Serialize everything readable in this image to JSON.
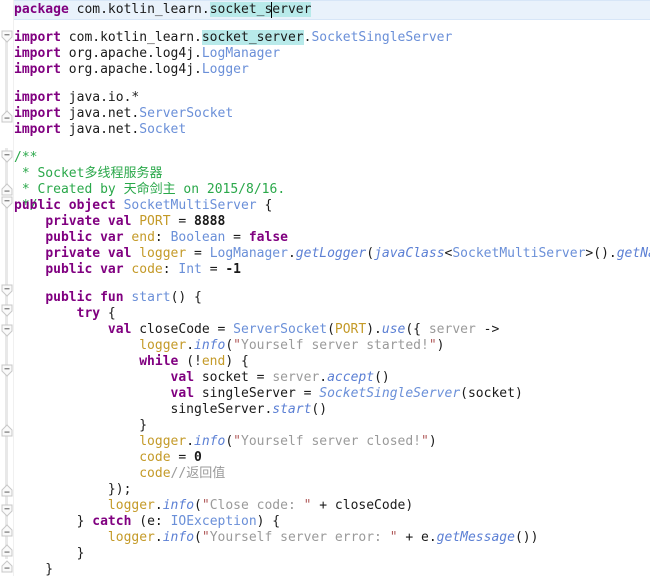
{
  "editor": {
    "language": "Kotlin",
    "file_package": "com.kotlin_learn.socket_server",
    "caret_line_index": 0,
    "highlight_token": "socket_server",
    "colors": {
      "background": "#ffffff",
      "caret_line": "#e9f2fb",
      "occurrence_highlight": "#b8eaea",
      "keyword": "#800080",
      "type": "#6a8fd8",
      "function": "#5b7fd4",
      "property": "#c49a28",
      "string": "#9a9a9a",
      "string_quote": "#b05a5a",
      "comment_block": "#2aa84a",
      "comment_line": "#9a9a9a",
      "number": "#1a1a1a",
      "gutter_rail": "#e8e8e8",
      "matched_brace": "#c87c20"
    }
  },
  "code": {
    "lines": [
      {
        "n": 1,
        "indent": 0,
        "text": "package com.kotlin_learn.socket_server"
      },
      {
        "n": 2,
        "indent": 0,
        "text": ""
      },
      {
        "n": 3,
        "indent": 0,
        "text": "import com.kotlin_learn.socket_server.SocketSingleServer"
      },
      {
        "n": 4,
        "indent": 0,
        "text": "import org.apache.log4j.LogManager"
      },
      {
        "n": 5,
        "indent": 0,
        "text": "import org.apache.log4j.Logger"
      },
      {
        "n": 6,
        "indent": 0,
        "text": ""
      },
      {
        "n": 7,
        "indent": 0,
        "text": "import java.io.*"
      },
      {
        "n": 8,
        "indent": 0,
        "text": "import java.net.ServerSocket"
      },
      {
        "n": 9,
        "indent": 0,
        "text": "import java.net.Socket"
      },
      {
        "n": 10,
        "indent": 0,
        "text": ""
      },
      {
        "n": 11,
        "indent": 0,
        "text": "/**"
      },
      {
        "n": 12,
        "indent": 0,
        "text": " * Socket多线程服务器"
      },
      {
        "n": 13,
        "indent": 0,
        "text": " * Created by 天命剑主 on 2015/8/16."
      },
      {
        "n": 14,
        "indent": 0,
        "text": " */"
      },
      {
        "n": 15,
        "indent": 0,
        "text": "public object SocketMultiServer {"
      },
      {
        "n": 16,
        "indent": 1,
        "text": "private val PORT = 8888"
      },
      {
        "n": 17,
        "indent": 1,
        "text": "public var end: Boolean = false"
      },
      {
        "n": 18,
        "indent": 1,
        "text": "private val logger = LogManager.getLogger(javaClass<SocketMultiServer>().getName())"
      },
      {
        "n": 19,
        "indent": 1,
        "text": "public var code: Int = -1"
      },
      {
        "n": 20,
        "indent": 0,
        "text": ""
      },
      {
        "n": 21,
        "indent": 1,
        "text": "public fun start() {"
      },
      {
        "n": 22,
        "indent": 2,
        "text": "try {"
      },
      {
        "n": 23,
        "indent": 3,
        "text": "val closeCode = ServerSocket(PORT).use({ server ->"
      },
      {
        "n": 24,
        "indent": 4,
        "text": "logger.info(\"Yourself server started!\")"
      },
      {
        "n": 25,
        "indent": 4,
        "text": "while (!end) {"
      },
      {
        "n": 26,
        "indent": 5,
        "text": "val socket = server.accept()"
      },
      {
        "n": 27,
        "indent": 5,
        "text": "val singleServer = SocketSingleServer(socket)"
      },
      {
        "n": 28,
        "indent": 5,
        "text": "singleServer.start()"
      },
      {
        "n": 29,
        "indent": 4,
        "text": "}"
      },
      {
        "n": 30,
        "indent": 4,
        "text": "logger.info(\"Yourself server closed!\")"
      },
      {
        "n": 31,
        "indent": 4,
        "text": "code = 0"
      },
      {
        "n": 32,
        "indent": 4,
        "text": "code//返回值"
      },
      {
        "n": 33,
        "indent": 3,
        "text": "});"
      },
      {
        "n": 34,
        "indent": 3,
        "text": "logger.info(\"Close code: \" + closeCode)"
      },
      {
        "n": 35,
        "indent": 2,
        "text": "} catch (e: IOException) {"
      },
      {
        "n": 36,
        "indent": 3,
        "text": "logger.info(\"Yourself server error: \" + e.getMessage())"
      },
      {
        "n": 37,
        "indent": 2,
        "text": "}"
      },
      {
        "n": 38,
        "indent": 1,
        "text": "}"
      },
      {
        "n": 39,
        "indent": 0,
        "text": "}"
      }
    ],
    "keywords": [
      "package",
      "import",
      "public",
      "private",
      "object",
      "val",
      "var",
      "fun",
      "try",
      "catch",
      "while"
    ],
    "types": [
      "SocketSingleServer",
      "LogManager",
      "Logger",
      "ServerSocket",
      "Socket",
      "SocketMultiServer",
      "Boolean",
      "Int",
      "IOException"
    ],
    "properties": [
      "PORT",
      "end",
      "logger",
      "code"
    ],
    "functions": [
      "getLogger",
      "javaClass",
      "getName",
      "start",
      "use",
      "info",
      "accept",
      "getMessage"
    ],
    "strings": [
      "\"Yourself server started!\"",
      "\"Yourself server closed!\"",
      "\"Close code: \"",
      "\"Yourself server error: \""
    ],
    "comments": {
      "block": [
        "/**",
        " * Socket多线程服务器",
        " * Created by 天命剑主 on 2015/8/16.",
        " */"
      ],
      "line": [
        "//返回值"
      ]
    },
    "numbers": [
      "8888",
      "0",
      "-1"
    ]
  },
  "gutter": {
    "fold_markers": [
      {
        "line": 3,
        "type": "expanded-start"
      },
      {
        "line": 9,
        "type": "region-end"
      },
      {
        "line": 11,
        "type": "expanded-start"
      },
      {
        "line": 14,
        "type": "region-end"
      },
      {
        "line": 15,
        "type": "expanded-start"
      },
      {
        "line": 21,
        "type": "expanded-start"
      },
      {
        "line": 22,
        "type": "expanded-start"
      },
      {
        "line": 23,
        "type": "expanded-start"
      },
      {
        "line": 25,
        "type": "expanded-start"
      },
      {
        "line": 29,
        "type": "region-end"
      },
      {
        "line": 33,
        "type": "region-end"
      },
      {
        "line": 35,
        "type": "expanded-start"
      },
      {
        "line": 37,
        "type": "region-end"
      },
      {
        "line": 38,
        "type": "region-end"
      },
      {
        "line": 39,
        "type": "region-end"
      }
    ]
  }
}
